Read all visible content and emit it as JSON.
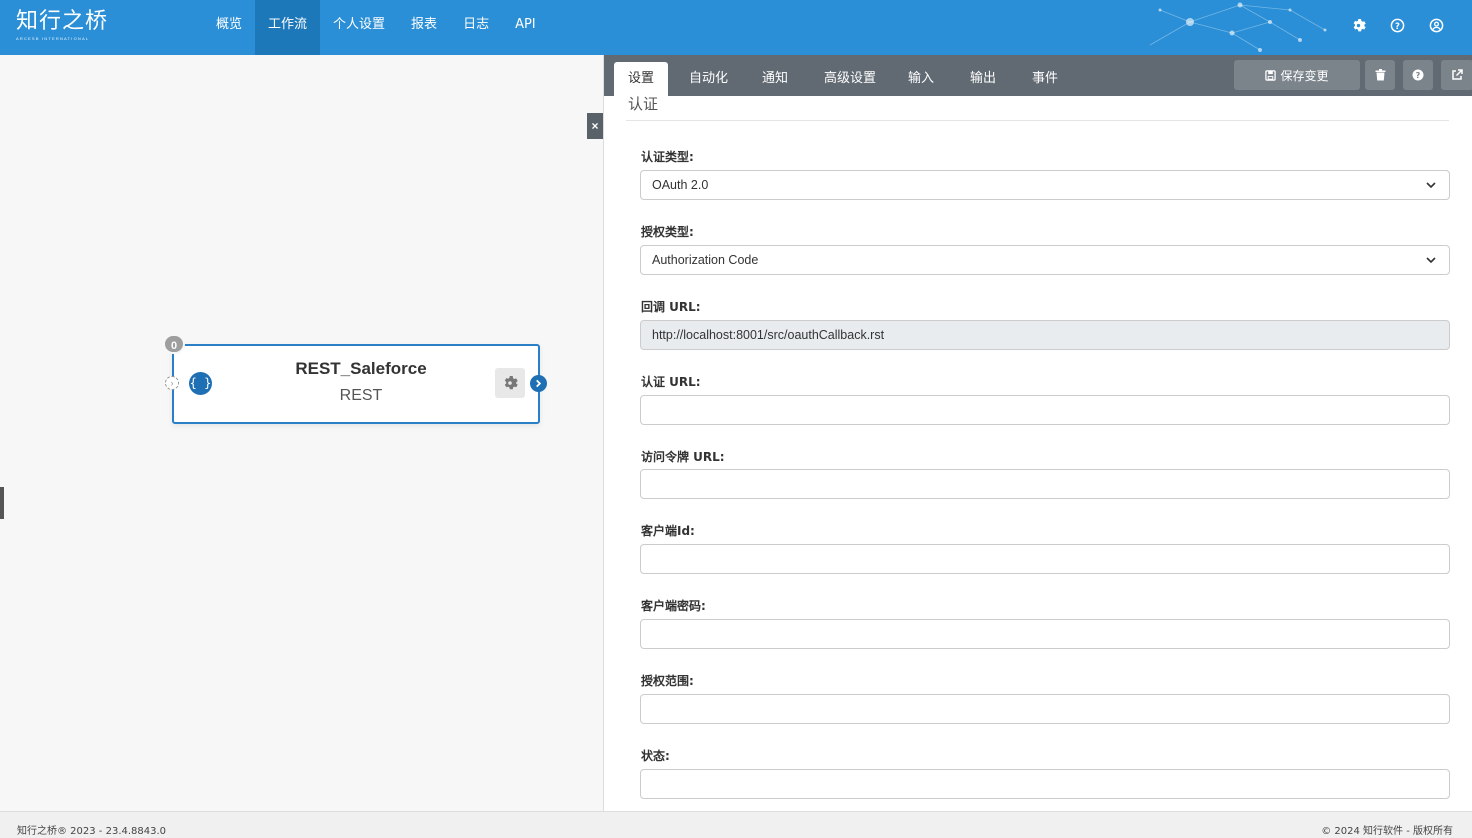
{
  "brand": {
    "name": "知行之桥",
    "tagline": "ARCESB INTERNATIONAL"
  },
  "nav": {
    "items": [
      {
        "label": "概览"
      },
      {
        "label": "工作流",
        "active": true
      },
      {
        "label": "个人设置"
      },
      {
        "label": "报表"
      },
      {
        "label": "日志"
      },
      {
        "label": "API"
      }
    ]
  },
  "header_icons": [
    "gear-icon",
    "help-icon",
    "user-icon"
  ],
  "canvas": {
    "node": {
      "title": "REST_Saleforce",
      "subtitle": "REST",
      "badge": "0",
      "icon_text": "{ }"
    },
    "collapse_label": "×"
  },
  "panel": {
    "tabs": [
      {
        "label": "设置",
        "active": true
      },
      {
        "label": "自动化"
      },
      {
        "label": "通知"
      },
      {
        "label": "高级设置"
      },
      {
        "label": "输入"
      },
      {
        "label": "输出"
      },
      {
        "label": "事件"
      }
    ],
    "actions": {
      "save_label": "保存变更"
    },
    "section_title": "认证",
    "fields": {
      "auth_type": {
        "label": "认证类型:",
        "value": "OAuth 2.0"
      },
      "grant_type": {
        "label": "授权类型:",
        "value": "Authorization Code"
      },
      "callback_url": {
        "label": "回调 URL:",
        "value": "http://localhost:8001/src/oauthCallback.rst"
      },
      "auth_url": {
        "label": "认证 URL:",
        "value": ""
      },
      "token_url": {
        "label": "访问令牌 URL:",
        "value": ""
      },
      "client_id": {
        "label": "客户端Id:",
        "value": ""
      },
      "client_secret": {
        "label": "客户端密码:",
        "value": ""
      },
      "scope": {
        "label": "授权范围:",
        "value": ""
      },
      "state": {
        "label": "状态:",
        "value": ""
      }
    }
  },
  "footer": {
    "left": "知行之桥® 2023 - 23.4.8843.0",
    "right": "© 2024 知行软件 - 版权所有"
  },
  "colors": {
    "header": "#2a8fd6",
    "header_active": "#1c78b9",
    "tabbar": "#616a73",
    "node_border": "#2a7fc7"
  }
}
